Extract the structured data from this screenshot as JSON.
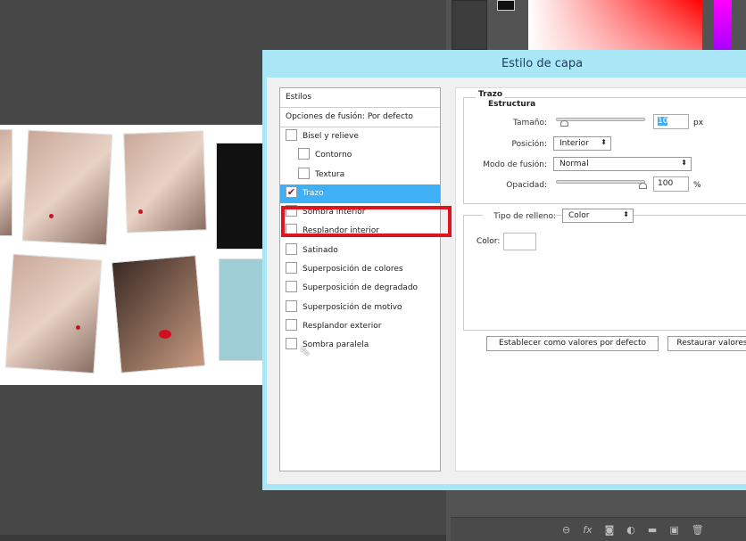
{
  "dialog": {
    "title": "Estilo de capa"
  },
  "styles": {
    "header": "Estilos",
    "blend_options": "Opciones de fusión: Por defecto",
    "items": [
      {
        "label": "Bisel y relieve",
        "checked": false
      },
      {
        "label": "Contorno",
        "checked": false
      },
      {
        "label": "Textura",
        "checked": false
      },
      {
        "label": "Trazo",
        "checked": true,
        "selected": true
      },
      {
        "label": "Sombra interior",
        "checked": false
      },
      {
        "label": "Resplandor interior",
        "checked": false
      },
      {
        "label": "Satinado",
        "checked": false
      },
      {
        "label": "Superposición de colores",
        "checked": false
      },
      {
        "label": "Superposición de degradado",
        "checked": false
      },
      {
        "label": "Superposición de motivo",
        "checked": false
      },
      {
        "label": "Resplandor exterior",
        "checked": false
      },
      {
        "label": "Sombra paralela",
        "checked": false
      }
    ]
  },
  "stroke": {
    "section": "Trazo",
    "structure": "Estructura",
    "size_label": "Tamaño:",
    "size_value": "10",
    "size_unit": "px",
    "position_label": "Posición:",
    "position_value": "Interior",
    "blend_label": "Modo de fusión:",
    "blend_value": "Normal",
    "opacity_label": "Opacidad:",
    "opacity_value": "100",
    "opacity_unit": "%",
    "fill_label": "Tipo de relleno:",
    "fill_value": "Color",
    "color_label": "Color:",
    "color_value": "#ffffff",
    "set_default": "Establecer como valores por defecto",
    "restore_default": "Restaurar valores"
  },
  "colors": {
    "highlight": "#e0141e",
    "selection": "#3fb0f5",
    "dialog_frame": "#a9e7f7"
  },
  "layers_bar_icons": [
    "link-icon",
    "fx-icon",
    "mask-icon",
    "adjustment-icon",
    "folder-icon",
    "new-layer-icon",
    "trash-icon"
  ]
}
